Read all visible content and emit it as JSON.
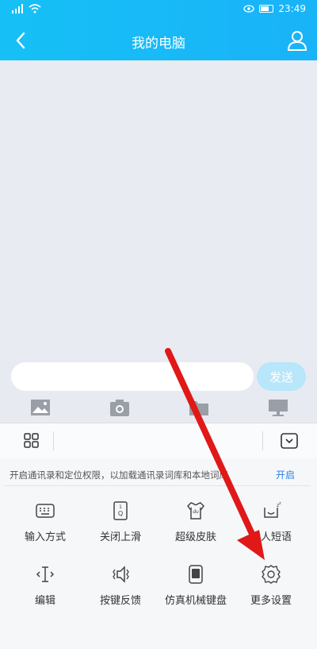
{
  "status_bar": {
    "time": "23:49"
  },
  "header": {
    "title": "我的电脑"
  },
  "input": {
    "placeholder": "",
    "send_label": "发送"
  },
  "toolbar_icons": [
    "image-icon",
    "camera-icon",
    "folder-icon",
    "computer-icon"
  ],
  "keyboard_panel": {
    "notice_text": "开启通讯录和定位权限，以加载通讯录词库和本地词库",
    "notice_action": "开启",
    "items": [
      {
        "label": "输入方式",
        "icon": "keyboard-icon"
      },
      {
        "label": "关闭上滑",
        "icon": "slide-up-icon"
      },
      {
        "label": "超级皮肤",
        "icon": "skin-icon"
      },
      {
        "label": "懒人短语",
        "icon": "phrase-icon"
      },
      {
        "label": "编辑",
        "icon": "edit-cursor-icon"
      },
      {
        "label": "按键反馈",
        "icon": "vibration-icon"
      },
      {
        "label": "仿真机械键盘",
        "icon": "mechanical-keyboard-icon"
      },
      {
        "label": "更多设置",
        "icon": "gear-icon"
      }
    ]
  },
  "colors": {
    "header": "#16c0f6",
    "send_disabled": "#b8e6fa",
    "link": "#2a82e4",
    "arrow": "#e01818"
  }
}
